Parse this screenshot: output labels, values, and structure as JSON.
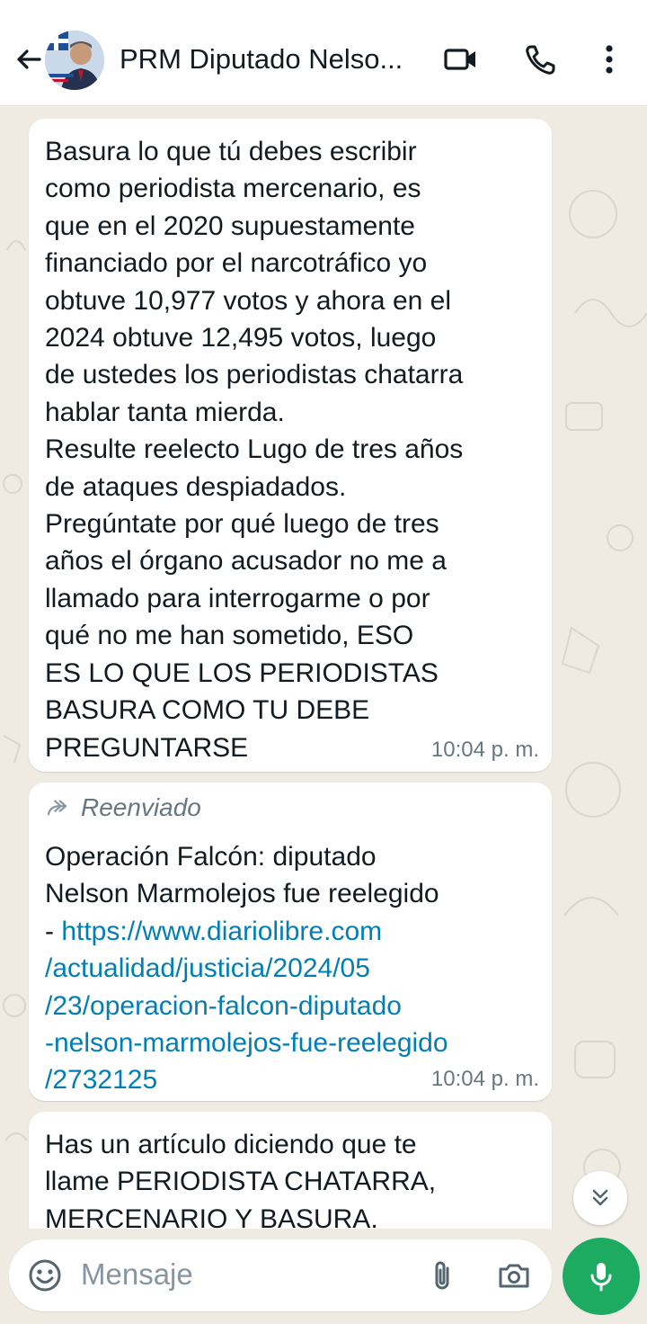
{
  "header": {
    "contact_name": "PRM Diputado Nelso...",
    "icons": [
      "back-arrow-icon",
      "video-call-icon",
      "voice-call-icon",
      "more-options-icon"
    ]
  },
  "messages": [
    {
      "text": "Basura lo que tú debes escribir\ncomo periodista mercenario, es\nque en el 2020 supuestamente\nfinanciado por el narcotráfico yo\nobtuve 10,977 votos y ahora en el\n2024 obtuve 12,495 votos, luego\nde ustedes los periodistas chatarra\nhablar tanta mierda.\nResulte reelecto Lugo de tres años\nde ataques despiadados.\nPregúntate por qué luego de tres\naños el órgano acusador no me a\nllamado para interrogarme o por\nqué no me han sometido, ESO\nES LO QUE LOS PERIODISTAS\nBASURA COMO TU DEBE\nPREGUNTARSE",
      "time": "10:04 p. m."
    },
    {
      "forwarded_label": "Reenviado",
      "text_before_link": "Operación Falcón: diputado\nNelson Marmolejos fue reelegido\n- ",
      "link": "https://www.diariolibre.com\n/actualidad/justicia/2024/05\n/23/operacion-falcon-diputado\n-nelson-marmolejos-fue-reelegido\n/2732125",
      "time": "10:04 p. m."
    },
    {
      "text": "Has un artículo diciendo que te\nllame PERIODISTA CHATARRA,\nMERCENARIO Y BASURA."
    }
  ],
  "composer": {
    "placeholder": "Mensaje",
    "icons": [
      "emoji-icon",
      "attach-icon",
      "camera-icon",
      "mic-icon"
    ]
  },
  "colors": {
    "background": "#efeae2",
    "bubble": "#ffffff",
    "link": "#027eb5",
    "mic_button": "#1daa61",
    "meta_text": "#667781"
  }
}
